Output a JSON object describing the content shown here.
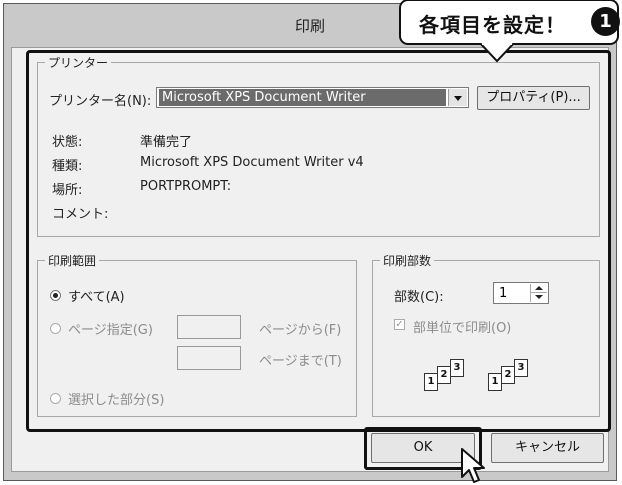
{
  "dialog": {
    "title": "印刷"
  },
  "callout": {
    "text": "各項目を設定！",
    "badge": "1"
  },
  "printer": {
    "group_label": "プリンター",
    "name_label": "プリンター名(N):",
    "name_value": "Microsoft XPS Document Writer",
    "properties_button": "プロパティ(P)...",
    "status_label": "状態:",
    "status_value": "準備完了",
    "type_label": "種類:",
    "type_value": "Microsoft XPS Document Writer v4",
    "where_label": "場所:",
    "where_value": "PORTPROMPT:",
    "comment_label": "コメント:"
  },
  "range": {
    "group_label": "印刷範囲",
    "all_label": "すべて(A)",
    "pages_label": "ページ指定(G)",
    "from_label": "ページから(F)",
    "to_label": "ページまで(T)",
    "selection_label": "選択した部分(S)"
  },
  "copies": {
    "group_label": "印刷部数",
    "count_label": "部数(C):",
    "count_value": "1",
    "collate_label": "部単位で印刷(O)",
    "collate_checked": true,
    "page_numbers": [
      "1",
      "2",
      "3"
    ]
  },
  "buttons": {
    "ok": "OK",
    "cancel": "キャンセル"
  },
  "colors": {
    "window_frame": "#c9c9c9",
    "client_bg": "#f0f0f0",
    "selection": "#6b6b6b",
    "highlight_border": "#111111"
  }
}
